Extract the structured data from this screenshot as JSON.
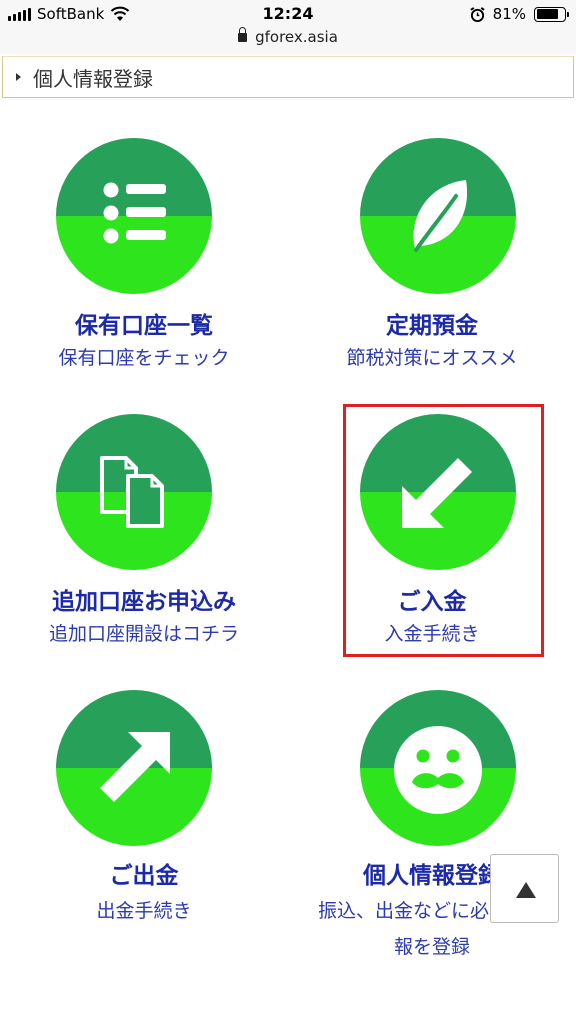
{
  "status_bar": {
    "carrier": "SoftBank",
    "time": "12:24",
    "url": "gforex.asia",
    "battery": "81%",
    "battery_level": 0.81
  },
  "breadcrumb": {
    "label": "個人情報登録"
  },
  "menu": [
    {
      "title": "保有口座一覧",
      "subtitle": "保有口座をチェック",
      "icon": "list-icon"
    },
    {
      "title": "定期預金",
      "subtitle": "節税対策にオススメ",
      "icon": "leaf-icon"
    },
    {
      "title": "追加口座お申込み",
      "subtitle": "追加口座開設はコチラ",
      "icon": "documents-icon"
    },
    {
      "title": "ご入金",
      "subtitle": "入金手続き",
      "icon": "arrow-down-left-icon"
    },
    {
      "title": "ご出金",
      "subtitle": "出金手続き",
      "icon": "arrow-up-right-icon"
    },
    {
      "title": "個人情報登録",
      "subtitle_line1": "振込、出金などに必要な情",
      "subtitle_line2": "報を登録",
      "icon": "mustache-face-icon"
    }
  ],
  "scroll_top_button": {
    "icon": "up-triangle-icon"
  },
  "colors": {
    "circle_top": "#27a159",
    "circle_bottom": "#2ee51d",
    "title_text": "#1d2aa8",
    "highlight_border": "#e02020"
  }
}
